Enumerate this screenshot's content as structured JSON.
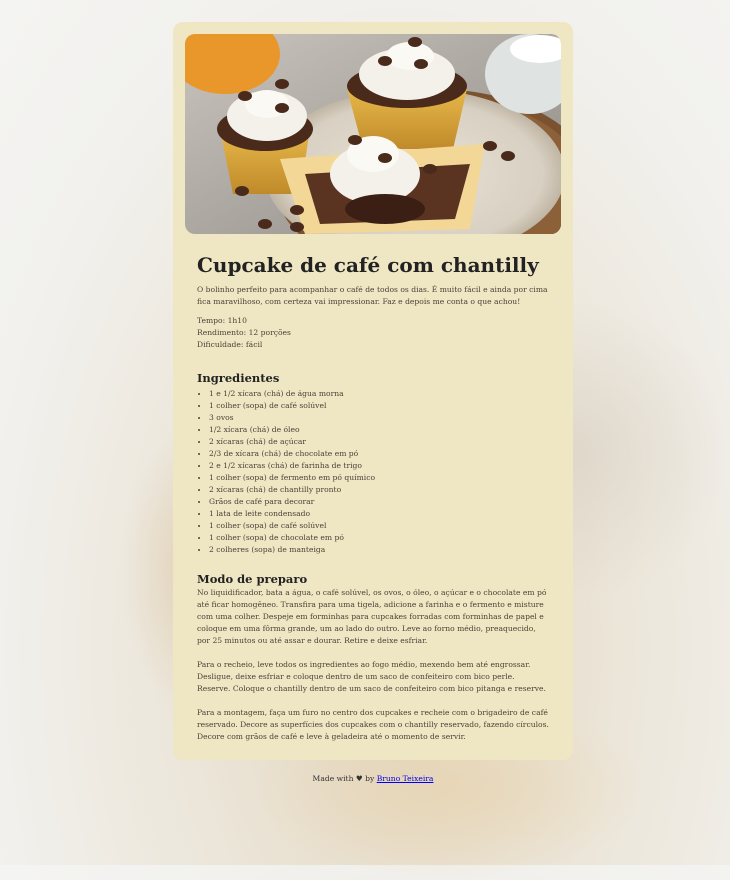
{
  "recipe": {
    "title": "Cupcake de café com chantilly",
    "intro": "O bolinho perfeito para acompanhar o café de todos os dias. É muito fácil e ainda por cima fica maravilhoso, com certeza vai impressionar. Faz e depois me conta o que achou!",
    "meta": {
      "time": "Tempo: 1h10",
      "yield": "Rendimento: 12 porções",
      "difficulty": "Dificuldade: fácil"
    },
    "ingredients_title": "Ingredientes",
    "ingredients": [
      "1 e 1/2 xícara (chá) de água morna",
      "1 colher (sopa) de café solúvel",
      "3 ovos",
      "1/2 xícara (chá) de óleo",
      "2 xícaras (chá) de açúcar",
      "2/3 de xícara (chá) de chocolate em pó",
      "2 e 1/2 xícaras (chá) de farinha de trigo",
      "1 colher (sopa) de fermento em pó químico",
      "2 xícaras (chá) de chantilly pronto",
      "Grãos de café para decorar",
      "1 lata de leite condensado",
      "1 colher (sopa) de café solúvel",
      "1 colher (sopa) de chocolate em pó",
      "2 colheres (sopa) de manteiga"
    ],
    "preparation_title": "Modo de preparo",
    "preparation": [
      "No liquidificador, bata a água, o café solúvel, os ovos, o óleo, o açúcar e o chocolate em pó até ficar homogêneo. Transfira para uma tigela, adicione a farinha e o fermento e misture com uma colher. Despeje em forminhas para cupcakes forradas com forminhas de papel e coloque em uma fôrma grande, um ao lado do outro. Leve ao forno médio, preaquecido, por 25 minutos ou até assar e dourar. Retire e deixe esfriar.",
      "Para o recheio, leve todos os ingredientes ao fogo médio, mexendo bem até engrossar. Desligue, deixe esfriar e coloque dentro de um saco de confeiteiro com bico perle. Reserve. Coloque o chantilly dentro de um saco de confeiteiro com bico pitanga e reserve.",
      "Para a montagem, faça um furo no centro dos cupcakes e recheie com o brigadeiro de café reservado. Decore as superfícies dos cupcakes com o chantilly reservado, fazendo círculos. Decore com grãos de café e leve à geladeira até o momento de servir."
    ]
  },
  "footer": {
    "prefix": "Made with ♥ by",
    "author": "Bruno Teixeira"
  },
  "colors": {
    "card_background": "#efe6c4",
    "heading": "#222222",
    "body_text": "#4a4236",
    "link": "#0000ee"
  }
}
